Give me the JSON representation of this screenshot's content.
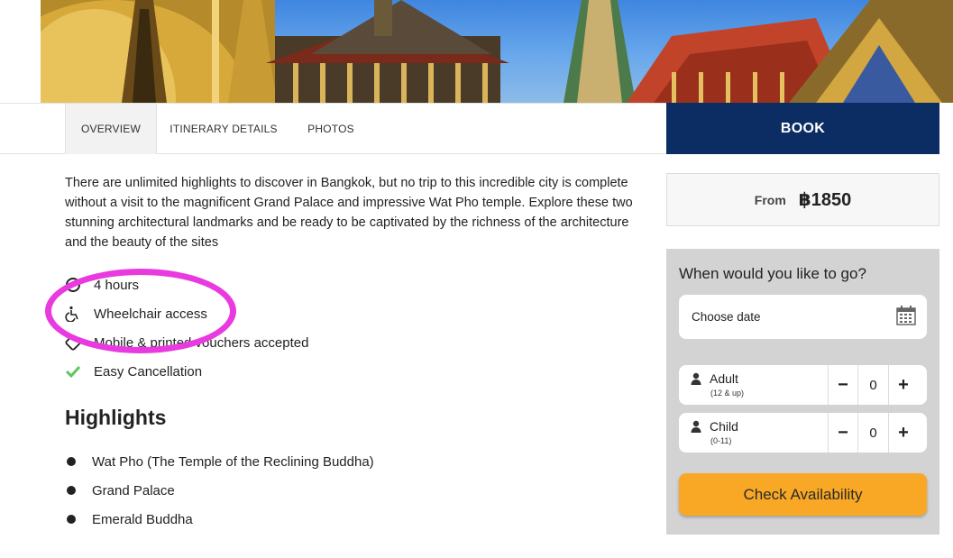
{
  "tabs": [
    {
      "label": "OVERVIEW",
      "active": true
    },
    {
      "label": "ITINERARY DETAILS",
      "active": false
    },
    {
      "label": "PHOTOS",
      "active": false
    }
  ],
  "book_label": "BOOK",
  "description": "There are unlimited highlights to discover in Bangkok, but no trip to this incredible city is complete without a visit to the magnificent Grand Palace and impressive Wat Pho temple. Explore these two stunning architectural landmarks and be ready to be captivated by the richness of the architecture and the beauty of the sites",
  "features": [
    {
      "icon": "clock-icon",
      "label": "4 hours"
    },
    {
      "icon": "wheelchair-icon",
      "label": "Wheelchair access"
    },
    {
      "icon": "ticket-icon",
      "label": "Mobile & printed vouchers accepted"
    },
    {
      "icon": "checkmark-icon",
      "label": "Easy Cancellation"
    }
  ],
  "highlights": {
    "title": "Highlights",
    "items": [
      "Wat Pho (The Temple of the Reclining Buddha)",
      "Grand Palace",
      "Emerald Buddha"
    ]
  },
  "price": {
    "from_label": "From",
    "value": "฿1850"
  },
  "booking": {
    "title": "When would you like to go?",
    "date_placeholder": "Choose date",
    "adult": {
      "label": "Adult",
      "sub": "(12 & up)",
      "value": "0"
    },
    "child": {
      "label": "Child",
      "sub": "(0-11)",
      "value": "0"
    },
    "minus": "−",
    "plus": "+",
    "check_label": "Check Availability"
  },
  "colors": {
    "book_bg": "#0c2d64",
    "check_bg": "#f9a825",
    "panel_bg": "#d3d3d3",
    "highlight_annotation": "#e93ae0",
    "check_icon": "#5cc85c"
  }
}
